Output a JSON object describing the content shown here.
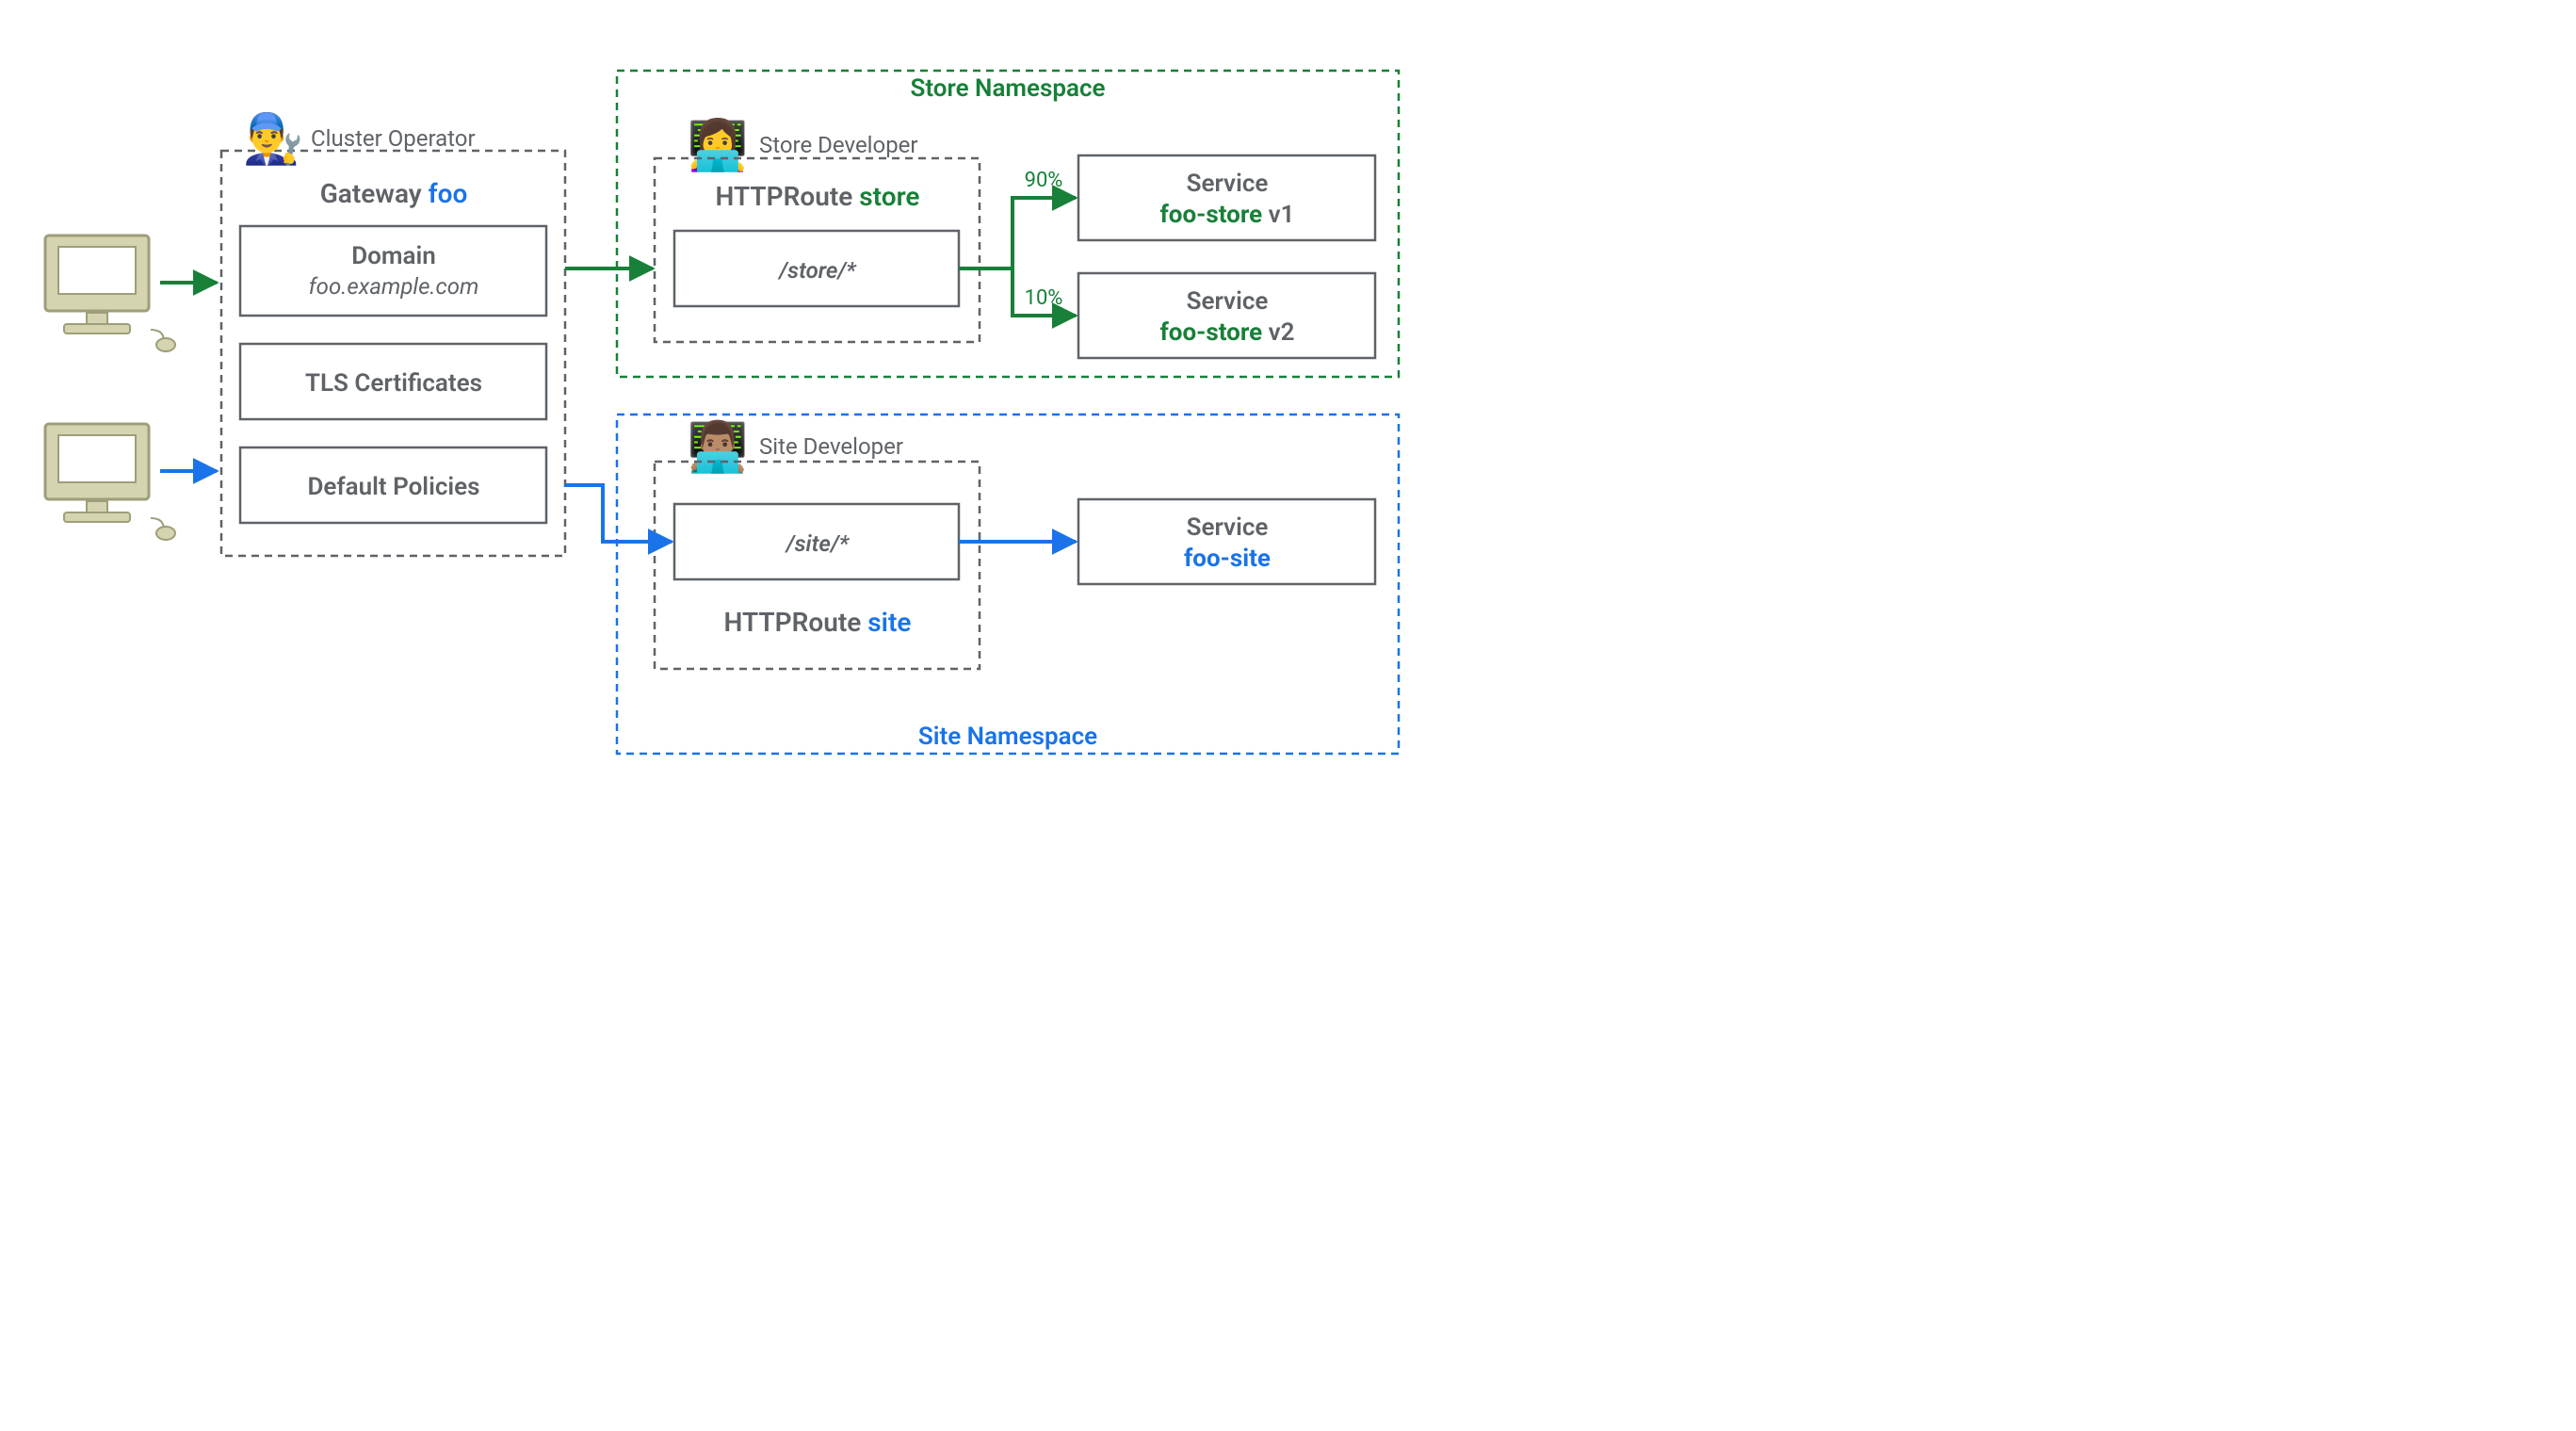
{
  "personas": {
    "cluster_operator": "Cluster Operator",
    "store_developer": "Store Developer",
    "site_developer": "Site Developer"
  },
  "gateway": {
    "title_prefix": "Gateway ",
    "title_name": "foo",
    "domain_label": "Domain",
    "domain_value": "foo.example.com",
    "tls": "TLS Certificates",
    "policies": "Default Policies"
  },
  "store": {
    "namespace_label": "Store Namespace",
    "route_title_prefix": "HTTPRoute ",
    "route_title_name": "store",
    "route_path": "/store/*",
    "split_90": "90%",
    "split_10": "10%",
    "svc1_line1": "Service",
    "svc1_name": "foo-store",
    "svc1_ver": " v1",
    "svc2_line1": "Service",
    "svc2_name": "foo-store",
    "svc2_ver": " v2"
  },
  "site": {
    "namespace_label": "Site Namespace",
    "route_title_prefix": "HTTPRoute ",
    "route_title_name": "site",
    "route_path": "/site/*",
    "svc_line1": "Service",
    "svc_name": "foo-site"
  }
}
